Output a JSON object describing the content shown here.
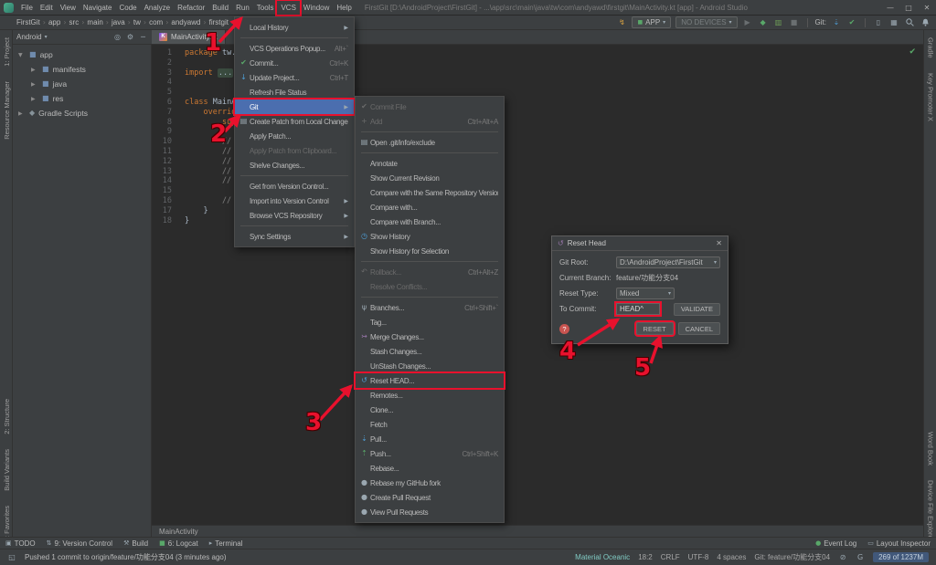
{
  "window": {
    "title": "FirstGit [D:\\AndroidProject\\FirstGit] - ...\\app\\src\\main\\java\\tw\\com\\andyawd\\firstgit\\MainActivity.kt [app] - Android Studio",
    "controls": {
      "minimize": "—",
      "maximize": "□",
      "close": "✕"
    }
  },
  "menubar": {
    "items": [
      "File",
      "Edit",
      "View",
      "Navigate",
      "Code",
      "Analyze",
      "Refactor",
      "Build",
      "Run",
      "Tools",
      "VCS",
      "Window",
      "Help"
    ],
    "highlighted": "VCS"
  },
  "navbar": {
    "breadcrumbs": [
      "FirstGit",
      "app",
      "src",
      "main",
      "java",
      "tw",
      "com",
      "andyawd",
      "firstgit",
      "MainActivity.kt"
    ],
    "run_config": "APP",
    "device": "NO DEVICES",
    "git_widget_label": "Git:"
  },
  "project_panel": {
    "mode": "Android",
    "tree": [
      {
        "label": "app",
        "indent": 0,
        "expanded": true,
        "icon": "app-folder-icon"
      },
      {
        "label": "manifests",
        "indent": 1,
        "icon": "folder-icon"
      },
      {
        "label": "java",
        "indent": 1,
        "icon": "folder-icon"
      },
      {
        "label": "res",
        "indent": 1,
        "icon": "folder-icon"
      },
      {
        "label": "Gradle Scripts",
        "indent": 0,
        "icon": "gradle-icon"
      }
    ]
  },
  "left_strip": {
    "top": [
      "1: Project",
      "Resource Manager"
    ],
    "bottom": [
      "2: Structure",
      "Build Variants",
      "1: Favorites"
    ]
  },
  "right_strip": {
    "top": [
      "Gradle",
      "Key Promoter X"
    ],
    "bottom": [
      "Word Book",
      "Device File Explorer"
    ]
  },
  "editor": {
    "tab": "MainActivity.kt",
    "breadcrumb": "MainActivity",
    "lines": [
      {
        "n": 1,
        "segs": [
          [
            "package",
            "kw"
          ],
          [
            " tw.com.andyawd.firstgit",
            "pl"
          ]
        ]
      },
      {
        "n": 2,
        "segs": []
      },
      {
        "n": 3,
        "segs": [
          [
            "import ",
            "kw"
          ],
          [
            "...",
            "fold"
          ]
        ]
      },
      {
        "n": 4,
        "segs": []
      },
      {
        "n": 5,
        "segs": []
      },
      {
        "n": 6,
        "segs": [
          [
            "class",
            "kw"
          ],
          [
            " MainActivity : AppCompatActivity() {",
            "pl"
          ]
        ]
      },
      {
        "n": 7,
        "segs": [
          [
            "    ",
            "pl"
          ],
          [
            "override fun",
            "kw"
          ],
          [
            " onCreate(savedInstanceState: Bundle?) {",
            "pl"
          ]
        ]
      },
      {
        "n": 8,
        "segs": [
          [
            "        ",
            "pl"
          ],
          [
            "super",
            "kw"
          ],
          [
            ".onCreate(savedInstanceState)",
            "pl"
          ]
        ]
      },
      {
        "n": 9,
        "segs": []
      },
      {
        "n": 10,
        "segs": [
          [
            "        // ...",
            "cm"
          ]
        ]
      },
      {
        "n": 11,
        "segs": [
          [
            "        // ...",
            "cm"
          ]
        ]
      },
      {
        "n": 12,
        "segs": [
          [
            "        // ...",
            "cm"
          ]
        ]
      },
      {
        "n": 13,
        "segs": [
          [
            "        // ...",
            "cm"
          ]
        ]
      },
      {
        "n": 14,
        "segs": [
          [
            "        // ...",
            "cm"
          ]
        ]
      },
      {
        "n": 15,
        "segs": []
      },
      {
        "n": 16,
        "segs": [
          [
            "        // ...",
            "cm"
          ]
        ]
      },
      {
        "n": 17,
        "segs": [
          [
            "    }",
            "pl"
          ]
        ]
      },
      {
        "n": 18,
        "segs": [
          [
            "}",
            "pl"
          ]
        ]
      }
    ]
  },
  "vcs_menu": {
    "items": [
      {
        "label": "Local History",
        "submenu": true
      },
      {
        "sep": true
      },
      {
        "label": "VCS Operations Popup...",
        "shortcut": "Alt+`"
      },
      {
        "label": "Commit...",
        "shortcut": "Ctrl+K",
        "icon": "commit-icon"
      },
      {
        "label": "Update Project...",
        "shortcut": "Ctrl+T",
        "icon": "update-icon"
      },
      {
        "label": "Refresh File Status"
      },
      {
        "label": "Git",
        "submenu": true,
        "selected": true,
        "annotated": true
      },
      {
        "label": "Create Patch from Local Changes...",
        "icon": "create-patch-icon"
      },
      {
        "label": "Apply Patch..."
      },
      {
        "label": "Apply Patch from Clipboard...",
        "disabled": true
      },
      {
        "label": "Shelve Changes..."
      },
      {
        "sep": true
      },
      {
        "label": "Get from Version Control..."
      },
      {
        "label": "Import into Version Control",
        "submenu": true
      },
      {
        "label": "Browse VCS Repository",
        "submenu": true
      },
      {
        "sep": true
      },
      {
        "label": "Sync Settings",
        "submenu": true
      }
    ]
  },
  "git_submenu": {
    "items": [
      {
        "label": "Commit File",
        "disabled": true,
        "icon": "commit-file-icon"
      },
      {
        "label": "Add",
        "shortcut": "Ctrl+Alt+A",
        "disabled": true,
        "icon": "add-icon"
      },
      {
        "sep": true
      },
      {
        "label": "Open .git/info/exclude",
        "icon": "exclude-icon"
      },
      {
        "sep": true
      },
      {
        "label": "Annotate"
      },
      {
        "label": "Show Current Revision"
      },
      {
        "label": "Compare with the Same Repository Version"
      },
      {
        "label": "Compare with..."
      },
      {
        "label": "Compare with Branch..."
      },
      {
        "label": "Show History",
        "icon": "history-icon"
      },
      {
        "label": "Show History for Selection"
      },
      {
        "sep": true
      },
      {
        "label": "Rollback...",
        "shortcut": "Ctrl+Alt+Z",
        "disabled": true,
        "icon": "rollback-icon"
      },
      {
        "label": "Resolve Conflicts...",
        "disabled": true
      },
      {
        "sep": true
      },
      {
        "label": "Branches...",
        "shortcut": "Ctrl+Shift+`",
        "icon": "branch-icon"
      },
      {
        "label": "Tag..."
      },
      {
        "label": "Merge Changes...",
        "icon": "merge-icon"
      },
      {
        "label": "Stash Changes..."
      },
      {
        "label": "UnStash Changes..."
      },
      {
        "label": "Reset HEAD...",
        "icon": "reset-icon",
        "annotated": true
      },
      {
        "label": "Remotes..."
      },
      {
        "label": "Clone..."
      },
      {
        "label": "Fetch"
      },
      {
        "label": "Pull...",
        "icon": "pull-icon"
      },
      {
        "label": "Push...",
        "shortcut": "Ctrl+Shift+K",
        "icon": "push-icon"
      },
      {
        "label": "Rebase..."
      },
      {
        "label": "Rebase my GitHub fork",
        "icon": "github-icon"
      },
      {
        "label": "Create Pull Request",
        "icon": "github-icon"
      },
      {
        "label": "View Pull Requests",
        "icon": "github-icon"
      }
    ]
  },
  "dialog": {
    "title": "Reset Head",
    "git_root_label": "Git Root:",
    "git_root_value": "D:\\AndroidProject\\FirstGit",
    "current_branch_label": "Current Branch:",
    "current_branch_value": "feature/功能分支04",
    "reset_type_label": "Reset Type:",
    "reset_type_value": "Mixed",
    "to_commit_label": "To Commit:",
    "to_commit_value": "HEAD^",
    "validate_label": "VALIDATE",
    "reset_label": "RESET",
    "cancel_label": "CANCEL"
  },
  "tool_tabs": {
    "left": [
      {
        "label": "TODO",
        "icon": "todo-icon"
      },
      {
        "label": "9: Version Control",
        "icon": "version-control-icon"
      },
      {
        "label": "Build",
        "icon": "build-icon"
      },
      {
        "label": "6: Logcat",
        "icon": "logcat-icon"
      },
      {
        "label": "Terminal",
        "icon": "terminal-icon"
      }
    ],
    "right": [
      {
        "label": "Event Log",
        "icon": "event-log-icon"
      },
      {
        "label": "Layout Inspector",
        "icon": "layout-inspector-icon"
      }
    ]
  },
  "status_bar": {
    "message": "Pushed 1 commit to origin/feature/功能分支04 (3 minutes ago)",
    "theme": "Material Oceanic",
    "caret_position": "18:2",
    "line_ending": "CRLF",
    "encoding": "UTF-8",
    "indent": "4 spaces",
    "git_branch": "Git: feature/功能分支04",
    "memory": "269 of 1237M"
  },
  "annotations": {
    "labels": [
      "1",
      "2",
      "3",
      "4",
      "5"
    ]
  }
}
